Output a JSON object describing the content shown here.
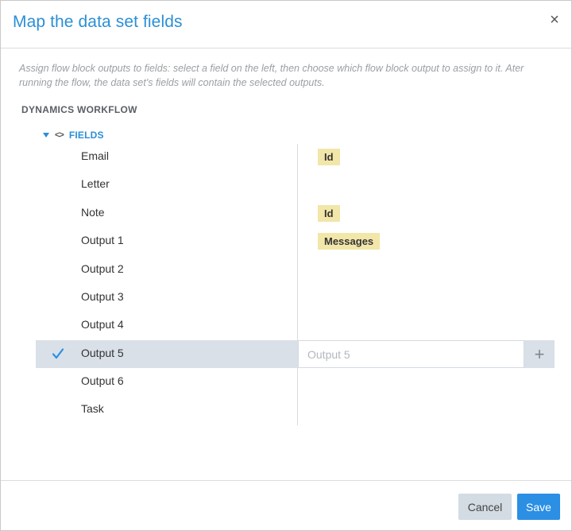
{
  "dialog": {
    "title": "Map the data set fields",
    "close_label": "×",
    "instructions": "Assign flow block outputs to fields: select a field on the left, then choose which flow block output to assign to it. Ater running the flow, the data set's fields will contain the selected outputs."
  },
  "section": {
    "title": "DYNAMICS WORKFLOW",
    "fields_label": "FIELDS",
    "fields_icon": "code-brackets-icon",
    "toggle_icon": "caret-down-icon"
  },
  "fields": [
    {
      "label": "Email",
      "output": "Id"
    },
    {
      "label": "Letter",
      "output": ""
    },
    {
      "label": "Note",
      "output": "Id"
    },
    {
      "label": "Output 1",
      "output": "Messages"
    },
    {
      "label": "Output 2",
      "output": ""
    },
    {
      "label": "Output 3",
      "output": ""
    },
    {
      "label": "Output 4",
      "output": ""
    },
    {
      "label": "Output 5",
      "output": "",
      "selected": true
    },
    {
      "label": "Output 6",
      "output": ""
    },
    {
      "label": "Task",
      "output": ""
    }
  ],
  "selected_field": {
    "input_placeholder": "Output 5",
    "input_value": "",
    "add_label": "+",
    "check_icon": "checkmark-icon"
  },
  "footer": {
    "cancel_label": "Cancel",
    "save_label": "Save"
  },
  "colors": {
    "accent": "#2b8fd6",
    "primary_button": "#2b8fe3",
    "selected_row": "#d9e0e8",
    "tag_background": "#f2e6a9"
  }
}
